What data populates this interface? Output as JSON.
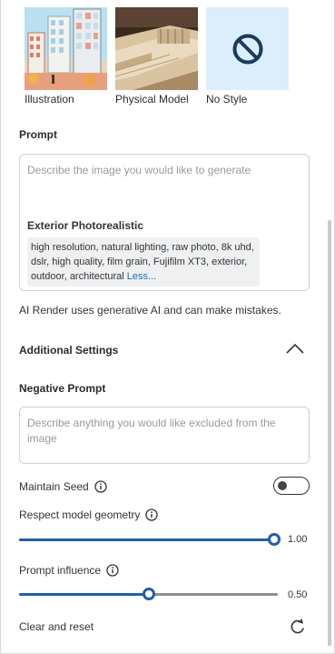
{
  "styles": [
    {
      "label": "Illustration"
    },
    {
      "label": "Physical Model"
    },
    {
      "label": "No Style"
    }
  ],
  "prompt": {
    "title": "Prompt",
    "placeholder": "Describe the image you would like to generate",
    "preset_title": "Exterior Photorealistic",
    "preset_tags": "high resolution, natural lighting, raw photo, 8k uhd, dslr, high quality, film grain, Fujifilm XT3, exterior, outdoor, architectural",
    "less_label": "Less..."
  },
  "disclaimer": "AI Render uses generative AI and can make mistakes.",
  "additional": {
    "title": "Additional Settings",
    "expanded": true
  },
  "negative": {
    "title": "Negative Prompt",
    "placeholder": "Describe anything you would like excluded from the image"
  },
  "maintain_seed": {
    "label": "Maintain Seed",
    "on": false
  },
  "respect_geometry": {
    "label": "Respect model geometry",
    "value": "1.00",
    "fraction": 1.0
  },
  "prompt_influence": {
    "label": "Prompt influence",
    "value": "0.50",
    "fraction": 0.5
  },
  "clear_reset": {
    "label": "Clear and reset"
  },
  "colors": {
    "accent": "#1f5fa8",
    "link": "#1a6fb0",
    "nostyle_bg": "#dceefb"
  }
}
